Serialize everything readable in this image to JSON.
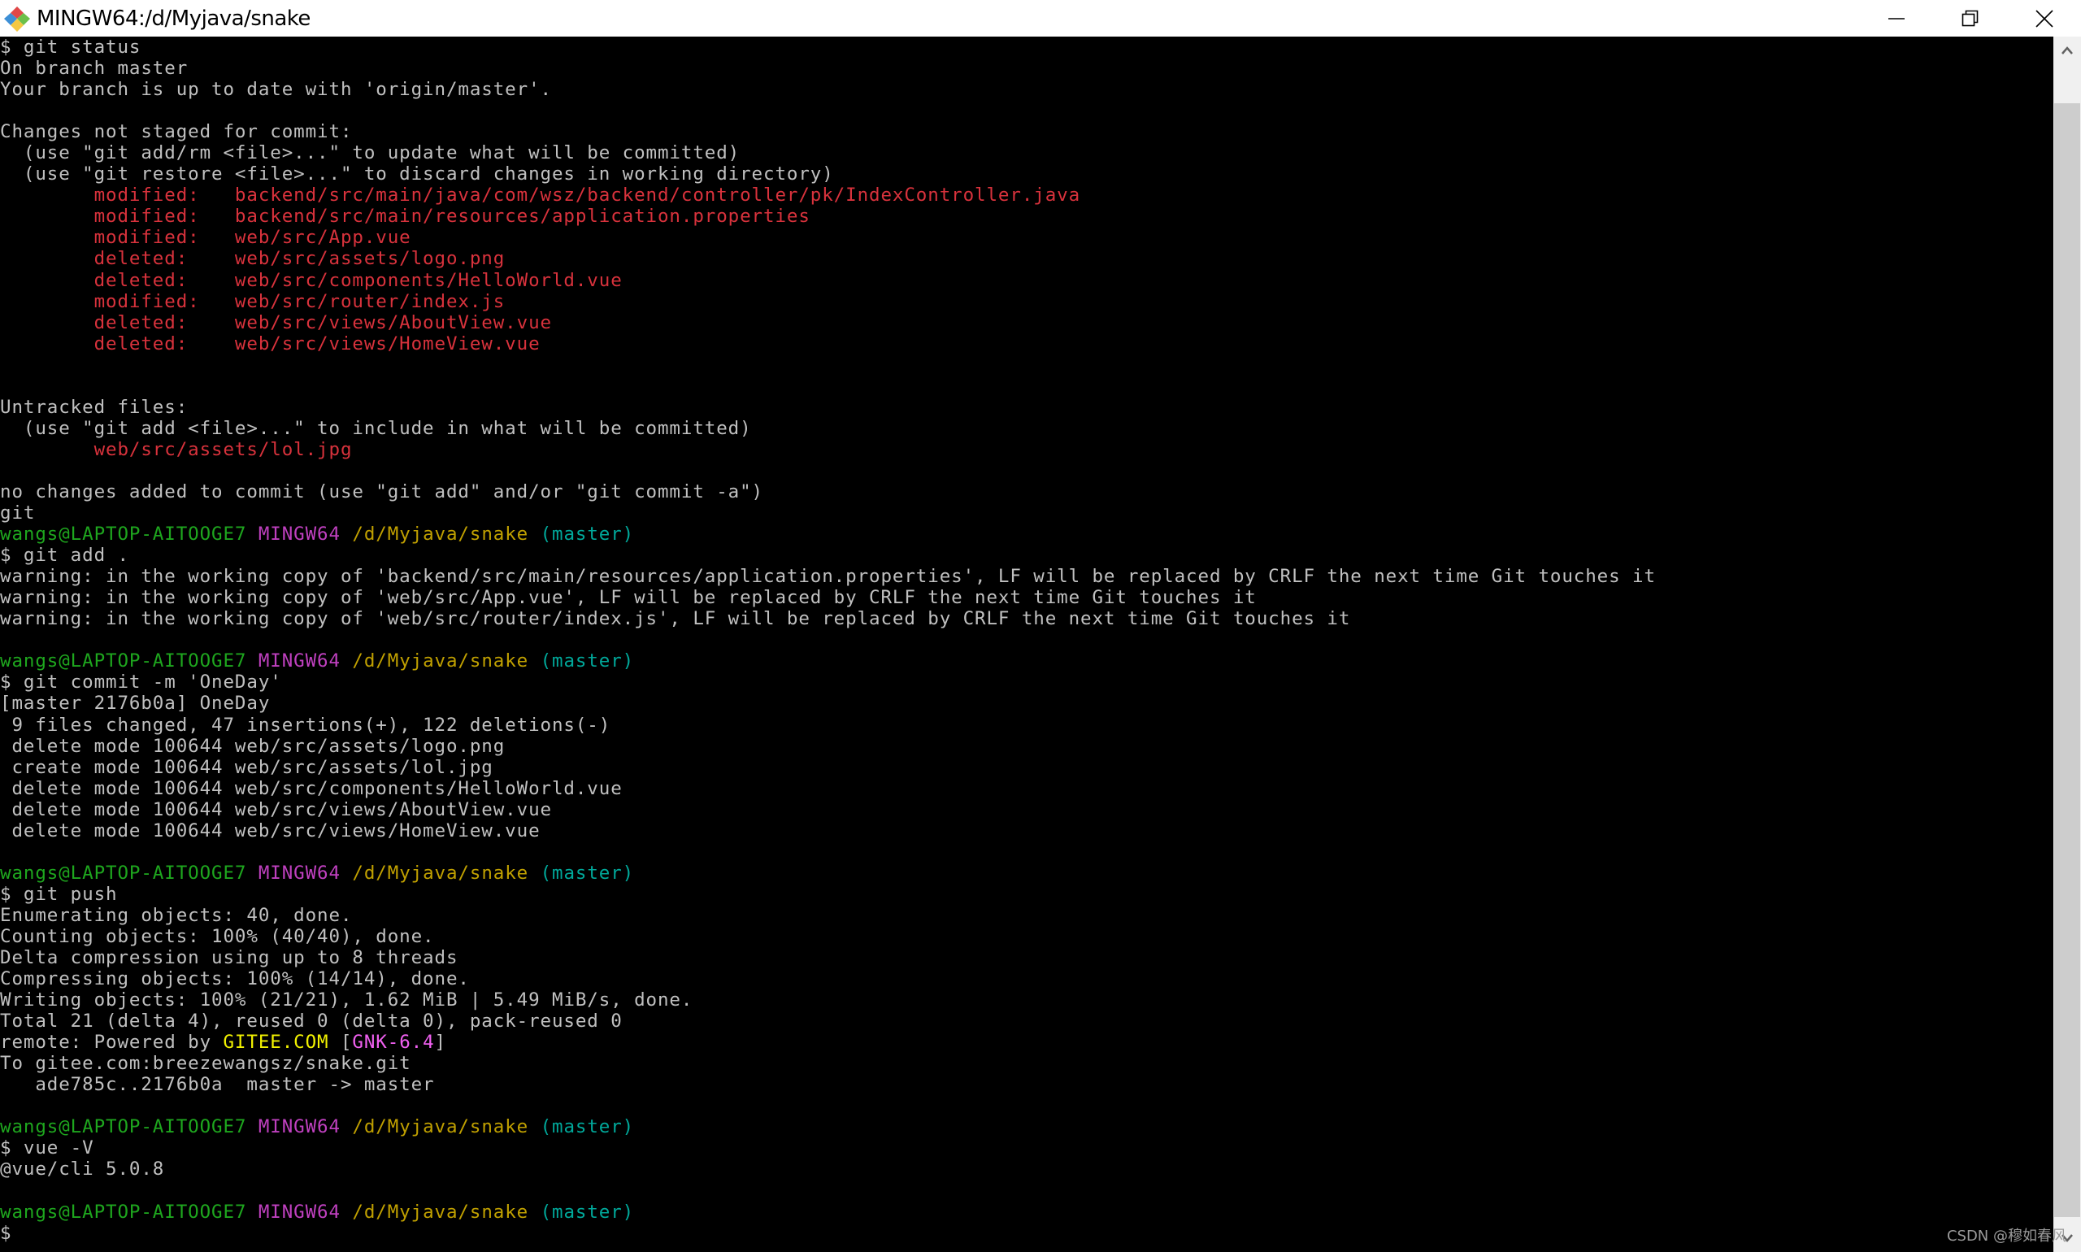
{
  "window": {
    "title": "MINGW64:/d/Myjava/snake",
    "icon": "git-bash-icon",
    "controls": [
      "minimize",
      "restore",
      "close"
    ]
  },
  "colors": {
    "default": "#c0c0c0",
    "red": "#d8323c",
    "green": "#1ea61e",
    "magenta": "#bf40bf",
    "yellow": "#c0a000",
    "cyan": "#00a89a",
    "bright_yellow": "#f2f200",
    "bright_magenta": "#f060f0",
    "background": "#000000"
  },
  "terminal": {
    "lines": [
      [
        {
          "t": "$ git status",
          "c": "default"
        }
      ],
      [
        {
          "t": "On branch master",
          "c": "default"
        }
      ],
      [
        {
          "t": "Your branch is up to date with 'origin/master'.",
          "c": "default"
        }
      ],
      [],
      [
        {
          "t": "Changes not staged for commit:",
          "c": "default"
        }
      ],
      [
        {
          "t": "  (use \"git add/rm <file>...\" to update what will be committed)",
          "c": "default"
        }
      ],
      [
        {
          "t": "  (use \"git restore <file>...\" to discard changes in working directory)",
          "c": "default"
        }
      ],
      [
        {
          "t": "        modified:   backend/src/main/java/com/wsz/backend/controller/pk/IndexController.java",
          "c": "red"
        }
      ],
      [
        {
          "t": "        modified:   backend/src/main/resources/application.properties",
          "c": "red"
        }
      ],
      [
        {
          "t": "        modified:   web/src/App.vue",
          "c": "red"
        }
      ],
      [
        {
          "t": "        deleted:    web/src/assets/logo.png",
          "c": "red"
        }
      ],
      [
        {
          "t": "        deleted:    web/src/components/HelloWorld.vue",
          "c": "red"
        }
      ],
      [
        {
          "t": "        modified:   web/src/router/index.js",
          "c": "red"
        }
      ],
      [
        {
          "t": "        deleted:    web/src/views/AboutView.vue",
          "c": "red"
        }
      ],
      [
        {
          "t": "        deleted:    web/src/views/HomeView.vue",
          "c": "red"
        }
      ],
      [],
      [],
      [
        {
          "t": "Untracked files:",
          "c": "default"
        }
      ],
      [
        {
          "t": "  (use \"git add <file>...\" to include in what will be committed)",
          "c": "default"
        }
      ],
      [
        {
          "t": "        web/src/assets/lol.jpg",
          "c": "red"
        }
      ],
      [],
      [
        {
          "t": "no changes added to commit (use \"git add\" and/or \"git commit -a\")",
          "c": "default"
        }
      ],
      [
        {
          "t": "git",
          "c": "default"
        }
      ],
      [
        {
          "t": "wangs@LAPTOP-AITOOGE7",
          "c": "green"
        },
        {
          "t": " ",
          "c": "default"
        },
        {
          "t": "MINGW64",
          "c": "magenta"
        },
        {
          "t": " ",
          "c": "default"
        },
        {
          "t": "/d/Myjava/snake",
          "c": "yellow"
        },
        {
          "t": " ",
          "c": "default"
        },
        {
          "t": "(master)",
          "c": "cyan"
        }
      ],
      [
        {
          "t": "$ git add .",
          "c": "default"
        }
      ],
      [
        {
          "t": "warning: in the working copy of 'backend/src/main/resources/application.properties', LF will be replaced by CRLF the next time Git touches it",
          "c": "default"
        }
      ],
      [
        {
          "t": "warning: in the working copy of 'web/src/App.vue', LF will be replaced by CRLF the next time Git touches it",
          "c": "default"
        }
      ],
      [
        {
          "t": "warning: in the working copy of 'web/src/router/index.js', LF will be replaced by CRLF the next time Git touches it",
          "c": "default"
        }
      ],
      [],
      [
        {
          "t": "wangs@LAPTOP-AITOOGE7",
          "c": "green"
        },
        {
          "t": " ",
          "c": "default"
        },
        {
          "t": "MINGW64",
          "c": "magenta"
        },
        {
          "t": " ",
          "c": "default"
        },
        {
          "t": "/d/Myjava/snake",
          "c": "yellow"
        },
        {
          "t": " ",
          "c": "default"
        },
        {
          "t": "(master)",
          "c": "cyan"
        }
      ],
      [
        {
          "t": "$ git commit -m 'OneDay'",
          "c": "default"
        }
      ],
      [
        {
          "t": "[master 2176b0a] OneDay",
          "c": "default"
        }
      ],
      [
        {
          "t": " 9 files changed, 47 insertions(+), 122 deletions(-)",
          "c": "default"
        }
      ],
      [
        {
          "t": " delete mode 100644 web/src/assets/logo.png",
          "c": "default"
        }
      ],
      [
        {
          "t": " create mode 100644 web/src/assets/lol.jpg",
          "c": "default"
        }
      ],
      [
        {
          "t": " delete mode 100644 web/src/components/HelloWorld.vue",
          "c": "default"
        }
      ],
      [
        {
          "t": " delete mode 100644 web/src/views/AboutView.vue",
          "c": "default"
        }
      ],
      [
        {
          "t": " delete mode 100644 web/src/views/HomeView.vue",
          "c": "default"
        }
      ],
      [],
      [
        {
          "t": "wangs@LAPTOP-AITOOGE7",
          "c": "green"
        },
        {
          "t": " ",
          "c": "default"
        },
        {
          "t": "MINGW64",
          "c": "magenta"
        },
        {
          "t": " ",
          "c": "default"
        },
        {
          "t": "/d/Myjava/snake",
          "c": "yellow"
        },
        {
          "t": " ",
          "c": "default"
        },
        {
          "t": "(master)",
          "c": "cyan"
        }
      ],
      [
        {
          "t": "$ git push",
          "c": "default"
        }
      ],
      [
        {
          "t": "Enumerating objects: 40, done.",
          "c": "default"
        }
      ],
      [
        {
          "t": "Counting objects: 100% (40/40), done.",
          "c": "default"
        }
      ],
      [
        {
          "t": "Delta compression using up to 8 threads",
          "c": "default"
        }
      ],
      [
        {
          "t": "Compressing objects: 100% (14/14), done.",
          "c": "default"
        }
      ],
      [
        {
          "t": "Writing objects: 100% (21/21), 1.62 MiB | 5.49 MiB/s, done.",
          "c": "default"
        }
      ],
      [
        {
          "t": "Total 21 (delta 4), reused 0 (delta 0), pack-reused 0",
          "c": "default"
        }
      ],
      [
        {
          "t": "remote: Powered by ",
          "c": "default"
        },
        {
          "t": "GITEE.COM",
          "c": "bright_yellow"
        },
        {
          "t": " [",
          "c": "default"
        },
        {
          "t": "GNK-6.4",
          "c": "bright_magenta"
        },
        {
          "t": "]",
          "c": "default"
        }
      ],
      [
        {
          "t": "To gitee.com:breezewangsz/snake.git",
          "c": "default"
        }
      ],
      [
        {
          "t": "   ade785c..2176b0a  master -> master",
          "c": "default"
        }
      ],
      [],
      [
        {
          "t": "wangs@LAPTOP-AITOOGE7",
          "c": "green"
        },
        {
          "t": " ",
          "c": "default"
        },
        {
          "t": "MINGW64",
          "c": "magenta"
        },
        {
          "t": " ",
          "c": "default"
        },
        {
          "t": "/d/Myjava/snake",
          "c": "yellow"
        },
        {
          "t": " ",
          "c": "default"
        },
        {
          "t": "(master)",
          "c": "cyan"
        }
      ],
      [
        {
          "t": "$ vue -V",
          "c": "default"
        }
      ],
      [
        {
          "t": "@vue/cli 5.0.8",
          "c": "default"
        }
      ],
      [],
      [
        {
          "t": "wangs@LAPTOP-AITOOGE7",
          "c": "green"
        },
        {
          "t": " ",
          "c": "default"
        },
        {
          "t": "MINGW64",
          "c": "magenta"
        },
        {
          "t": " ",
          "c": "default"
        },
        {
          "t": "/d/Myjava/snake",
          "c": "yellow"
        },
        {
          "t": " ",
          "c": "default"
        },
        {
          "t": "(master)",
          "c": "cyan"
        }
      ],
      [
        {
          "t": "$",
          "c": "default"
        }
      ]
    ]
  },
  "watermark": "CSDN @穆如春风"
}
